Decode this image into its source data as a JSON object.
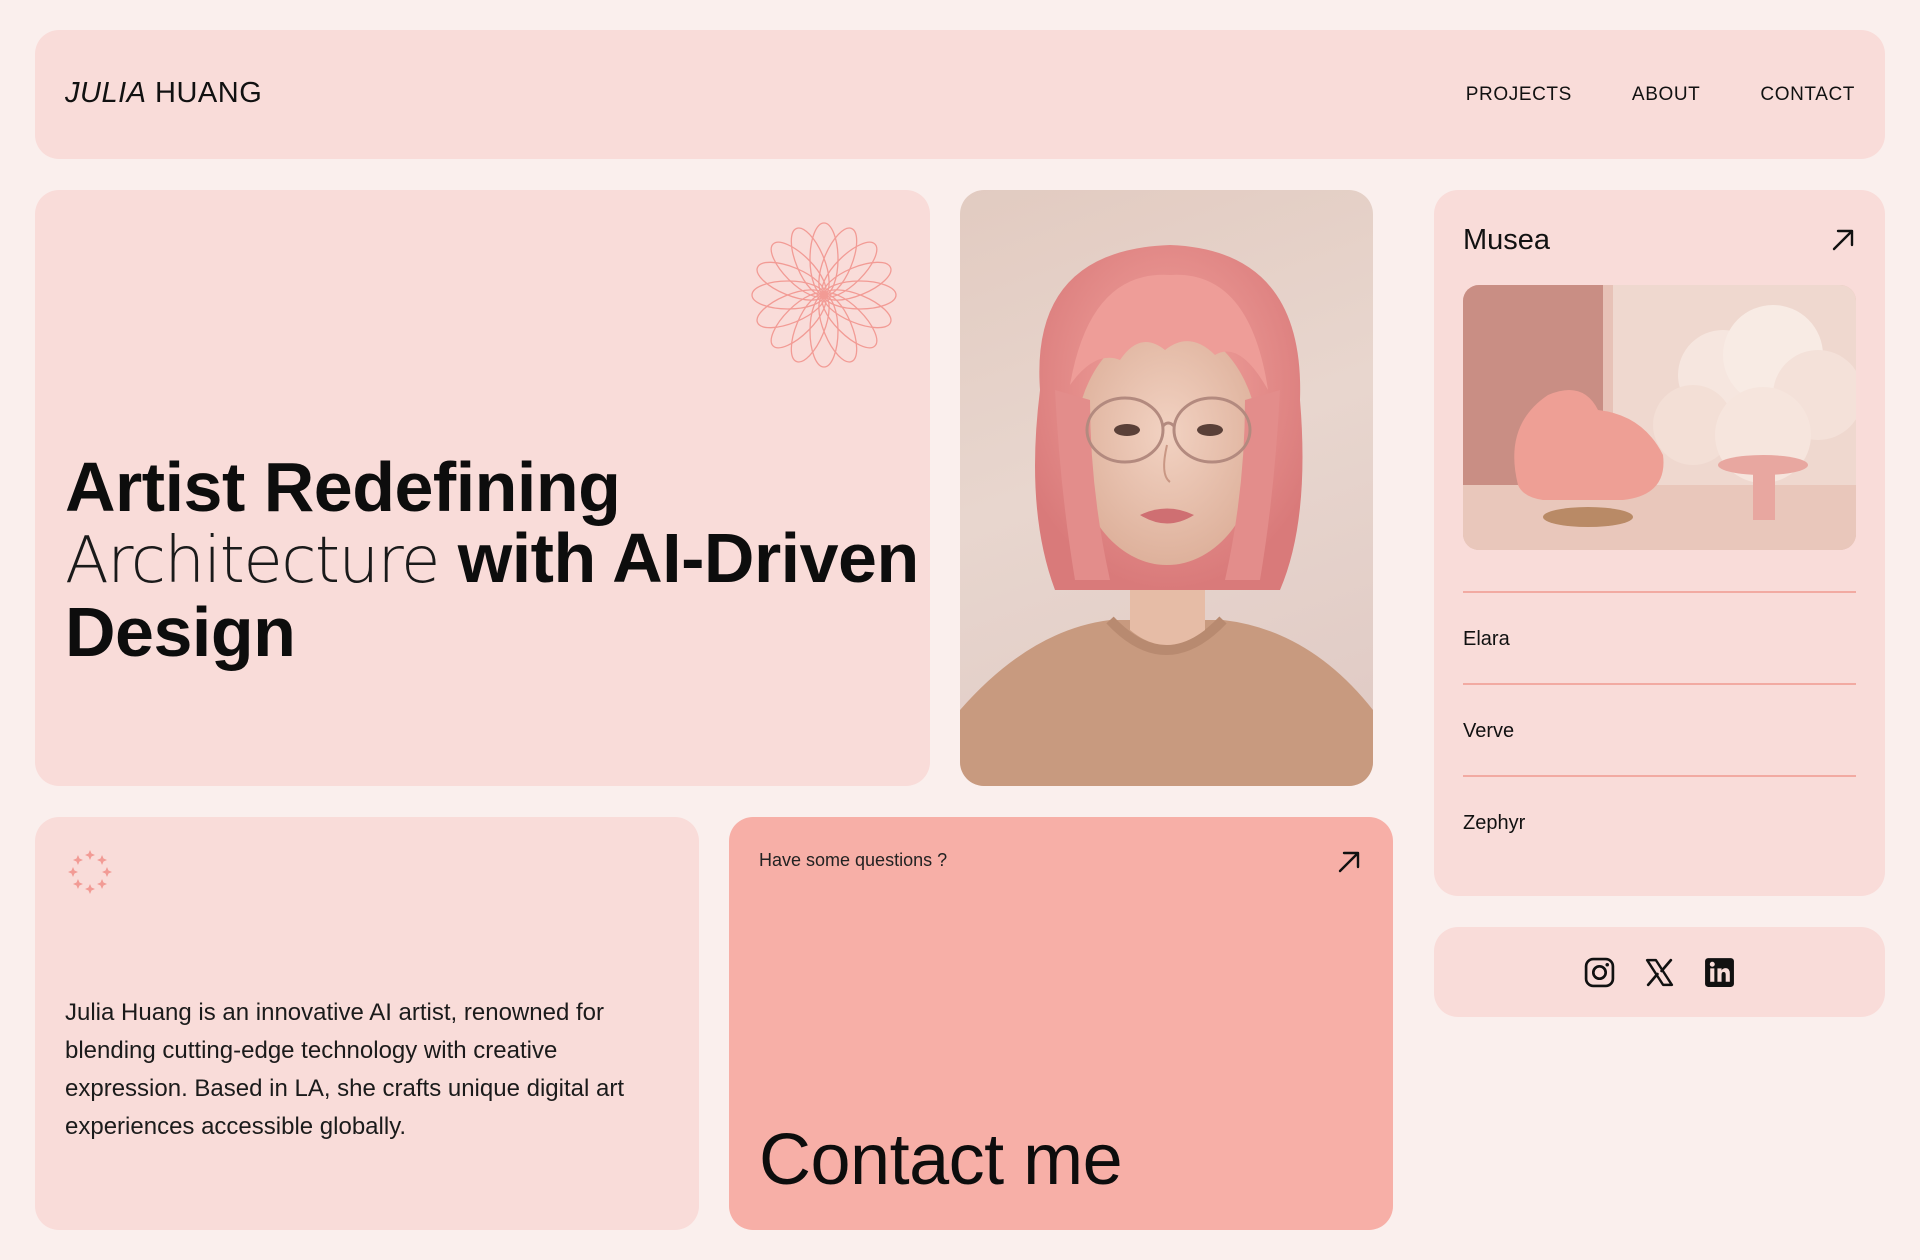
{
  "header": {
    "logo_first": "JULIA",
    "logo_last": "HUANG",
    "nav": [
      "PROJECTS",
      "ABOUT",
      "CONTACT"
    ]
  },
  "hero": {
    "line1": "Artist Redefining",
    "line2_thin": "Architecture",
    "line2_bold": " with AI-Driven",
    "line3": "Design",
    "flower_icon": "flower-outline-icon"
  },
  "portrait": {
    "alt": "Portrait of woman with pink bob haircut and glasses"
  },
  "projects": {
    "title": "Musea",
    "arrow_icon": "arrow-up-right-icon",
    "items": [
      "Elara",
      "Verve",
      "Zephyr"
    ]
  },
  "social": {
    "icons": [
      "instagram-icon",
      "x-icon",
      "linkedin-icon"
    ]
  },
  "about": {
    "text": "Julia Huang is an innovative AI artist, renowned for blending cutting-edge technology with creative expression. Based in LA, she crafts unique digital art experiences accessible globally.",
    "sparkle_icon": "sparkle-ring-icon"
  },
  "contact": {
    "question": "Have some questions ?",
    "cta": "Contact me",
    "arrow_icon": "arrow-up-right-icon"
  },
  "colors": {
    "background": "#faefed",
    "card": "#f9dcd9",
    "contact_card": "#f7afa7",
    "accent": "#f2aaa2"
  }
}
